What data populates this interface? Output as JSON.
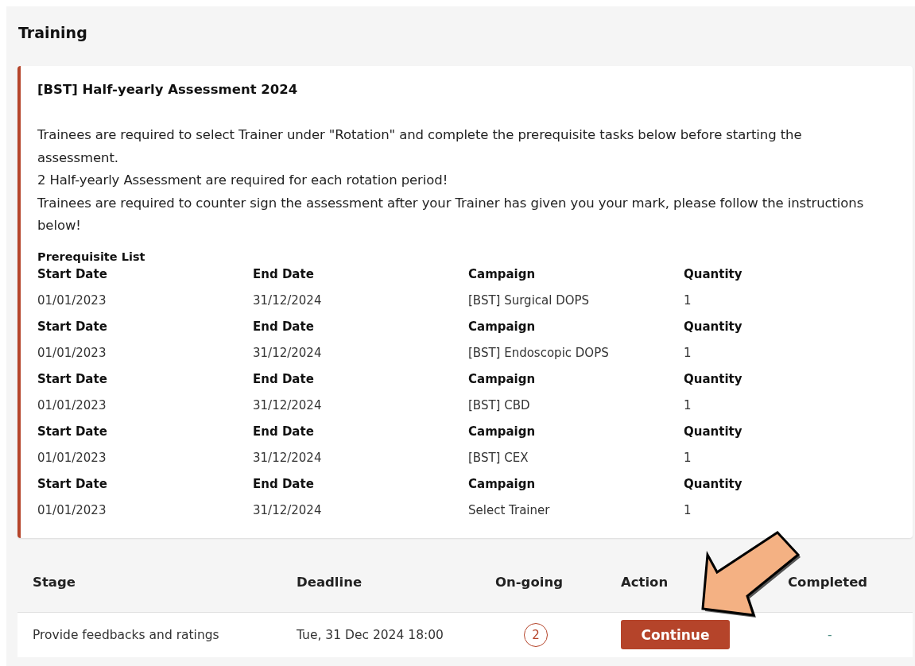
{
  "section": {
    "title": "Training"
  },
  "assessment": {
    "title": "[BST] Half-yearly Assessment 2024",
    "instructions": [
      "Trainees are required to select Trainer under \"Rotation\" and complete the prerequisite tasks below before starting the assessment.",
      "2 Half-yearly Assessment are required for each rotation period!",
      "Trainees are required to counter sign the assessment after your Trainer has given you your mark, please follow the instructions below!"
    ],
    "prerequisite_title": "Prerequisite List",
    "prerequisites": [
      {
        "headers": [
          "Start Date",
          "End Date",
          "Campaign",
          "Quantity"
        ],
        "values": [
          "01/01/2023",
          "31/12/2024",
          "[BST] Surgical DOPS",
          "1"
        ]
      },
      {
        "headers": [
          "Start Date",
          "End Date",
          "Campaign",
          "Quantity"
        ],
        "values": [
          "01/01/2023",
          "31/12/2024",
          "[BST] Endoscopic DOPS",
          "1"
        ]
      },
      {
        "headers": [
          "Start Date",
          "End Date",
          "Campaign",
          "Quantity"
        ],
        "values": [
          "01/01/2023",
          "31/12/2024",
          "[BST] CBD",
          "1"
        ]
      },
      {
        "headers": [
          "Start Date",
          "End Date",
          "Campaign",
          "Quantity"
        ],
        "values": [
          "01/01/2023",
          "31/12/2024",
          "[BST] CEX",
          "1"
        ]
      },
      {
        "headers": [
          "Start Date",
          "End Date",
          "Campaign",
          "Quantity"
        ],
        "values": [
          "01/01/2023",
          "31/12/2024",
          "Select Trainer",
          "1"
        ]
      }
    ]
  },
  "table": {
    "columns": [
      "Stage",
      "Deadline",
      "On-going",
      "Action",
      "Completed"
    ],
    "rows": [
      {
        "stage": "Provide feedbacks and ratings",
        "deadline": "Tue, 31 Dec 2024 18:00",
        "ongoing": "2",
        "action": "Continue",
        "completed": "-"
      }
    ]
  }
}
